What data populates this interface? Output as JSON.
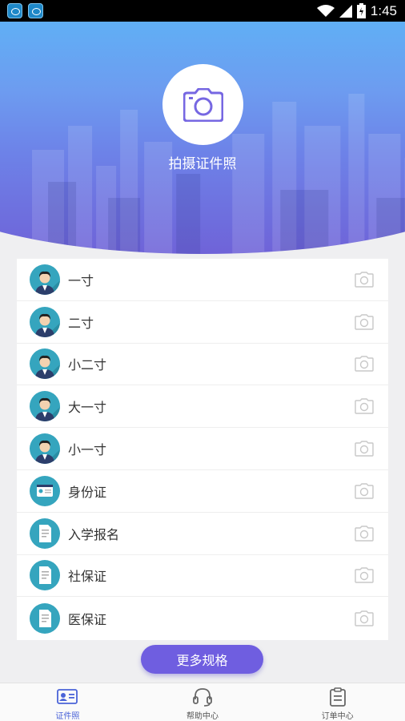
{
  "status_bar": {
    "time": "1:45"
  },
  "hero": {
    "title": "拍摄证件照"
  },
  "list": {
    "items": [
      {
        "label": "一寸",
        "icon": "person-avatar-icon"
      },
      {
        "label": "二寸",
        "icon": "person-avatar-icon"
      },
      {
        "label": "小二寸",
        "icon": "person-avatar-icon"
      },
      {
        "label": "大一寸",
        "icon": "person-avatar-icon"
      },
      {
        "label": "小一寸",
        "icon": "person-avatar-icon"
      },
      {
        "label": "身份证",
        "icon": "id-card-icon"
      },
      {
        "label": "入学报名",
        "icon": "document-icon"
      },
      {
        "label": "社保证",
        "icon": "document-icon"
      },
      {
        "label": "医保证",
        "icon": "document-icon"
      }
    ]
  },
  "more_button": {
    "label": "更多规格"
  },
  "tabs": [
    {
      "label": "证件照",
      "icon": "id-photo-icon",
      "active": true
    },
    {
      "label": "帮助中心",
      "icon": "headset-icon",
      "active": false
    },
    {
      "label": "订单中心",
      "icon": "order-list-icon",
      "active": false
    }
  ],
  "colors": {
    "accent": "#6f5ee0",
    "avatar_bg": "#35a5be",
    "tab_active": "#4a63d8"
  }
}
